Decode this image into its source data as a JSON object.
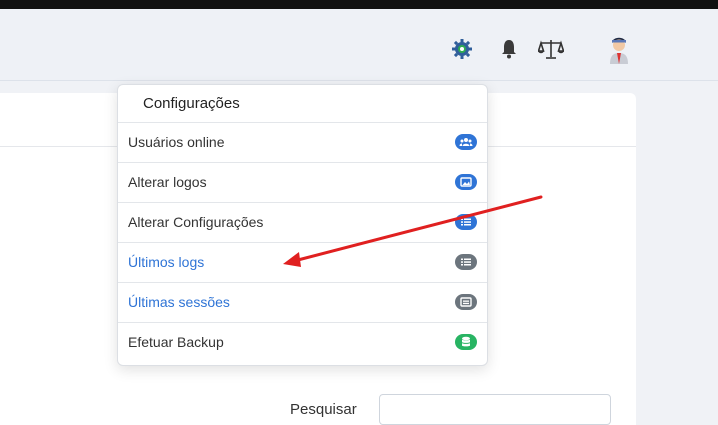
{
  "menu": {
    "title": "Configurações",
    "items": [
      {
        "label": "Usuários online",
        "badge_color": "#2f74d6",
        "icon": "users-icon"
      },
      {
        "label": "Alterar logos",
        "badge_color": "#2f74d6",
        "icon": "image-icon"
      },
      {
        "label": "Alterar Configurações",
        "badge_color": "#2f74d6",
        "icon": "list-icon"
      },
      {
        "label": "Últimos logs",
        "badge_color": "#6c757d",
        "icon": "list-icon"
      },
      {
        "label": "Últimas sessões",
        "badge_color": "#6c757d",
        "icon": "window-icon"
      },
      {
        "label": "Efetuar Backup",
        "badge_color": "#28b463",
        "icon": "database-icon"
      }
    ]
  },
  "search": {
    "label": "Pesquisar",
    "value": ""
  },
  "topbar": {
    "icons": [
      "settings-icon",
      "bell-icon",
      "scales-icon",
      "user-avatar-icon"
    ]
  },
  "annotation": {
    "arrow_color": "#e02020"
  }
}
